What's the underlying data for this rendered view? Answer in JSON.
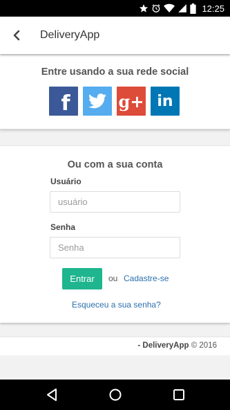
{
  "status_bar": {
    "time": "12:25",
    "icons": [
      "star-icon",
      "alarm-icon",
      "wifi-icon",
      "signal-icon",
      "battery-icon"
    ]
  },
  "app_bar": {
    "title": "DeliveryApp",
    "back_icon": "chevron-left-icon"
  },
  "social": {
    "heading": "Entre usando a sua rede social",
    "buttons": [
      {
        "name": "facebook",
        "glyph": "f",
        "color": "#3b5998"
      },
      {
        "name": "twitter",
        "glyph": "twitter-bird-icon",
        "color": "#55acee"
      },
      {
        "name": "google-plus",
        "glyph": "g+",
        "color": "#dd4b39"
      },
      {
        "name": "linkedin",
        "glyph": "in",
        "color": "#0077b5"
      }
    ]
  },
  "login": {
    "heading": "Ou com a sua conta",
    "username_label": "Usuário",
    "username_placeholder": "usuário",
    "username_value": "",
    "password_label": "Senha",
    "password_placeholder": "Senha",
    "password_value": "",
    "submit_label": "Entrar",
    "or_text": "ou",
    "register_link": "Cadastre-se",
    "forgot_link": "Esqueceu a sua senha?",
    "accent_color": "#1fb58f",
    "link_color": "#2b6fad"
  },
  "footer": {
    "brand": "- DeliveryApp",
    "copyright": "© 2016"
  },
  "nav_bar": {
    "icons": [
      "back-triangle-icon",
      "home-circle-icon",
      "recents-square-icon"
    ]
  }
}
